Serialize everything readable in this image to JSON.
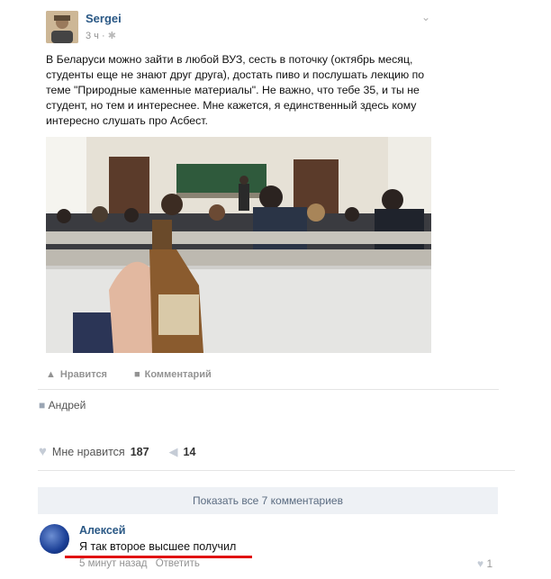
{
  "post": {
    "author": "Sergei",
    "time": "3 ч · ",
    "text": "В Беларуси можно зайти в любой ВУЗ, сесть в поточку (октябрь месяц, студенты еще не знают друг друга), достать пиво и послушать лекцию по теме \"Природные каменные материалы\". Не важно, что тебе 35, и ты не студент, но тем и интереснее. Мне кажется, я единственный здесь кому интересно слушать про Асбест.",
    "like_label": "Нравится",
    "comment_label": "Комментарий",
    "shared_by": "Андрей",
    "likes_label": "Мне нравится",
    "likes_count": "187",
    "reposts_count": "14"
  },
  "comments": {
    "show_all": "Показать все 7 комментариев",
    "items": [
      {
        "author": "Алексей",
        "text": "Я так второе высшее получил",
        "time": "5 минут назад",
        "reply": "Ответить",
        "likes": "1"
      }
    ]
  },
  "icons": {
    "like": "heart-icon",
    "repost": "megaphone-icon",
    "user": "user-icon",
    "chevron": "chevron-down-icon"
  },
  "colors": {
    "link": "#2a5885",
    "muted": "#939393",
    "accent": "#e01010"
  }
}
